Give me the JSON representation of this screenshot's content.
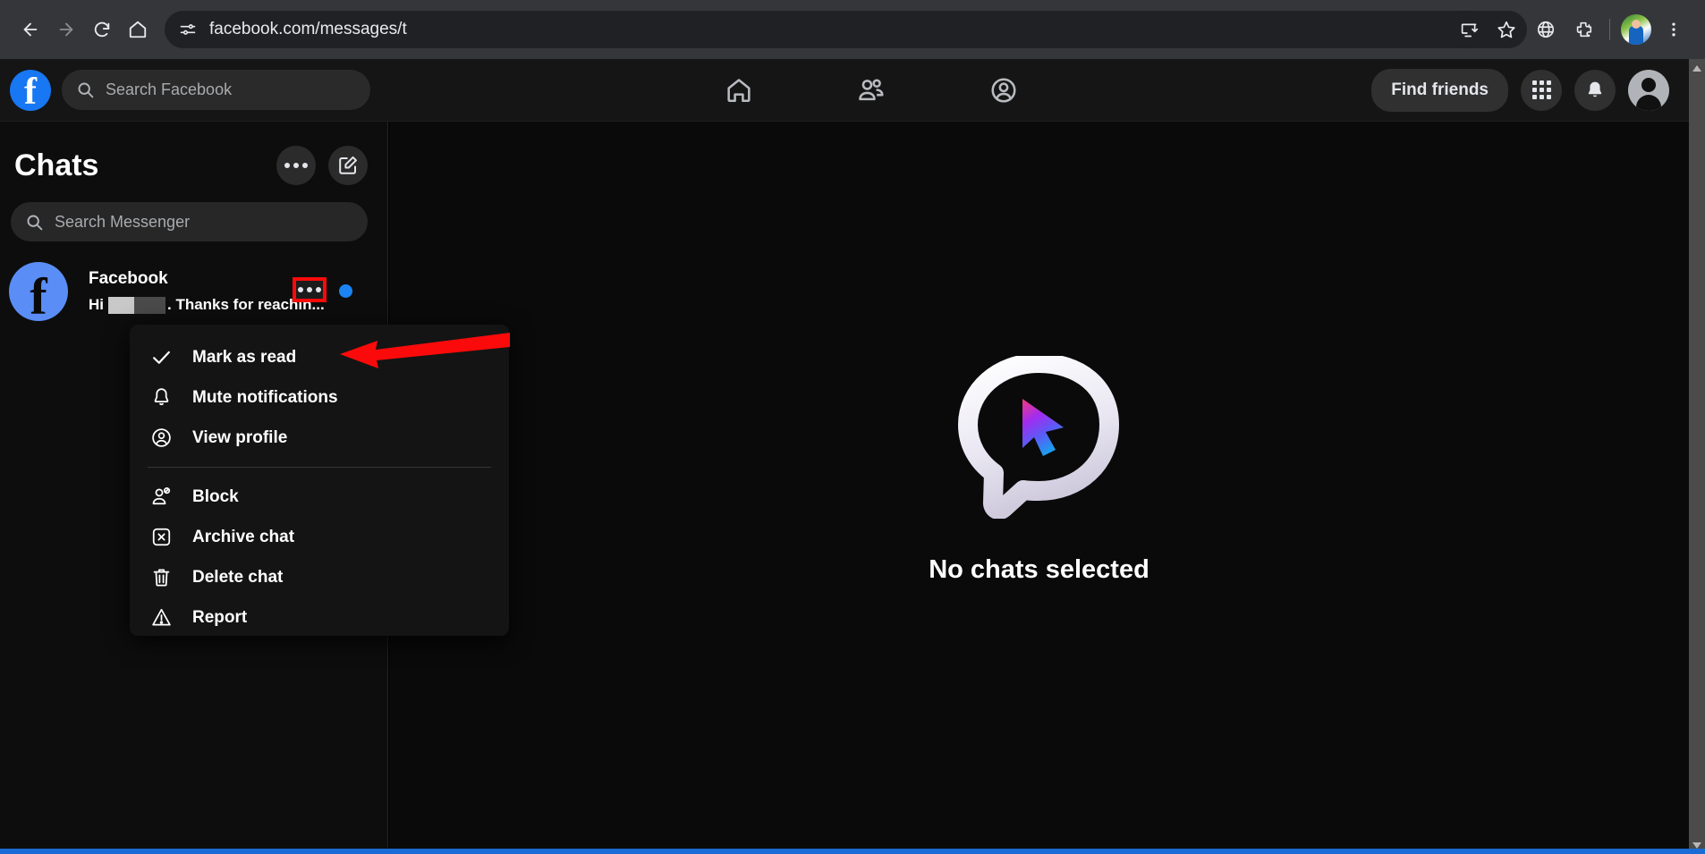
{
  "browser": {
    "back_icon": "back-arrow-icon",
    "forward_icon": "forward-arrow-icon",
    "reload_icon": "reload-icon",
    "home_icon": "home-icon",
    "site_info_icon": "site-settings-icon",
    "url": "facebook.com/messages/t",
    "install_icon": "install-app-icon",
    "bookmark_icon": "star-bookmark-icon",
    "translate_icon": "globe-translate-icon",
    "extensions_icon": "extensions-puzzle-icon",
    "profile_icon": "browser-profile-avatar",
    "menu_icon": "three-dot-menu-icon"
  },
  "fb_header": {
    "logo": "facebook-logo",
    "logo_letter": "f",
    "search_placeholder": "Search Facebook",
    "search_icon": "search-icon",
    "nav": [
      {
        "name": "home",
        "icon": "home-icon"
      },
      {
        "name": "friends",
        "icon": "friends-icon"
      },
      {
        "name": "profile-groups",
        "icon": "person-circle-icon"
      }
    ],
    "find_friends_label": "Find friends",
    "apps_icon": "grid-apps-icon",
    "notifications_icon": "bell-icon",
    "account_icon": "account-avatar-icon"
  },
  "sidebar": {
    "title": "Chats",
    "options_icon": "three-dots-icon",
    "compose_icon": "compose-new-message-icon",
    "search_placeholder": "Search Messenger",
    "search_icon": "search-icon",
    "chats": [
      {
        "name": "Facebook",
        "avatar_letter": "f",
        "preview_prefix": "Hi",
        "preview_suffix": ". Thanks for reachin...",
        "more_icon": "chat-more-options-icon",
        "unread": true
      }
    ],
    "scrollbar": {
      "up_icon": "scroll-up-arrow",
      "down_icon": "scroll-down-arrow"
    }
  },
  "context_menu": {
    "items": [
      {
        "label": "Mark as read",
        "icon": "checkmark-icon",
        "group": 1
      },
      {
        "label": "Mute notifications",
        "icon": "bell-icon",
        "group": 1
      },
      {
        "label": "View profile",
        "icon": "person-circle-icon",
        "group": 1
      },
      {
        "label": "Block",
        "icon": "block-person-icon",
        "group": 2
      },
      {
        "label": "Archive chat",
        "icon": "archive-box-x-icon",
        "group": 2
      },
      {
        "label": "Delete chat",
        "icon": "trash-can-icon",
        "group": 2
      },
      {
        "label": "Report",
        "icon": "warning-triangle-icon",
        "group": 2
      }
    ]
  },
  "main": {
    "empty_icon": "messenger-bubble-cursor-logo",
    "empty_title": "No chats selected"
  },
  "annotations": {
    "highlight_color": "#fa0a0a",
    "arrow_color": "#fa0a0a",
    "highlight_target": "chat-more-options-icon",
    "arrow_target": "Mark as read"
  },
  "colors": {
    "facebook_blue": "#1877f2",
    "unread_dot": "#1b84f2",
    "page_background": "#0a0a0a",
    "sidebar_background": "#0d0d0d",
    "menu_background": "#141414"
  }
}
